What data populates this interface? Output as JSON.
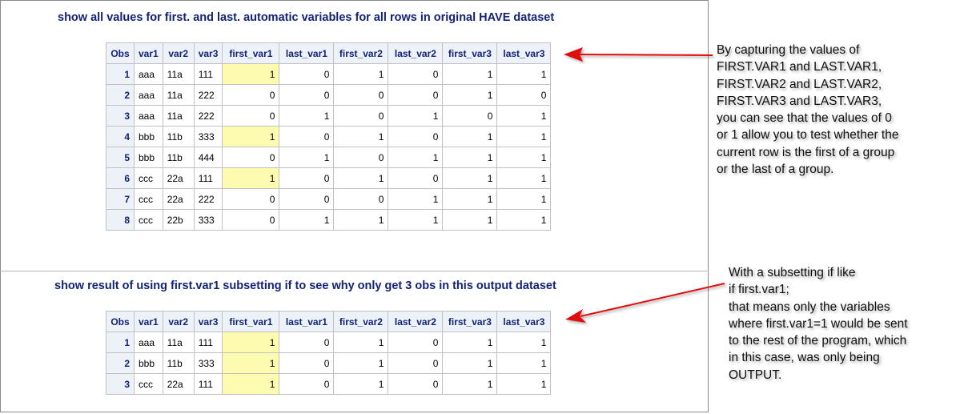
{
  "titles": {
    "first": "show all values for first. and last. automatic variables for all rows in original HAVE dataset",
    "second": "show result of using first.var1 subsetting if to see why only get 3 obs in this output dataset"
  },
  "columns": [
    "Obs",
    "var1",
    "var2",
    "var3",
    "first_var1",
    "last_var1",
    "first_var2",
    "last_var2",
    "first_var3",
    "last_var3"
  ],
  "table1_rows": [
    [
      "1",
      "aaa",
      "11a",
      "111",
      "1",
      "0",
      "1",
      "0",
      "1",
      "1"
    ],
    [
      "2",
      "aaa",
      "11a",
      "222",
      "0",
      "0",
      "0",
      "0",
      "1",
      "0"
    ],
    [
      "3",
      "aaa",
      "11a",
      "222",
      "0",
      "1",
      "0",
      "1",
      "0",
      "1"
    ],
    [
      "4",
      "bbb",
      "11b",
      "333",
      "1",
      "0",
      "1",
      "0",
      "1",
      "1"
    ],
    [
      "5",
      "bbb",
      "11b",
      "444",
      "0",
      "1",
      "0",
      "1",
      "1",
      "1"
    ],
    [
      "6",
      "ccc",
      "22a",
      "111",
      "1",
      "0",
      "1",
      "0",
      "1",
      "1"
    ],
    [
      "7",
      "ccc",
      "22a",
      "222",
      "0",
      "0",
      "0",
      "1",
      "1",
      "1"
    ],
    [
      "8",
      "ccc",
      "22b",
      "333",
      "0",
      "1",
      "1",
      "1",
      "1",
      "1"
    ]
  ],
  "table2_rows": [
    [
      "1",
      "aaa",
      "11a",
      "111",
      "1",
      "0",
      "1",
      "0",
      "1",
      "1"
    ],
    [
      "2",
      "bbb",
      "11b",
      "333",
      "1",
      "0",
      "1",
      "0",
      "1",
      "1"
    ],
    [
      "3",
      "ccc",
      "22a",
      "111",
      "1",
      "0",
      "1",
      "0",
      "1",
      "1"
    ]
  ],
  "notes": {
    "first": [
      "By capturing the values of",
      "FIRST.VAR1 and LAST.VAR1,",
      "FIRST.VAR2 and LAST.VAR2,",
      "FIRST.VAR3 and LAST.VAR3,",
      "you can see that the values of 0",
      "or 1 allow you to test whether the",
      "current row is the first of a group",
      "or the last of a group."
    ],
    "second": [
      "With a subsetting if like",
      "if first.var1;",
      "that means only the variables",
      "where first.var1=1 would be sent",
      "to the rest of the program, which",
      "in this case, was only being",
      "OUTPUT."
    ]
  },
  "colors": {
    "header_text": "#112277",
    "header_bg": "#edf2f9",
    "highlight": "#fdfbb0",
    "arrow": "#e01010"
  }
}
